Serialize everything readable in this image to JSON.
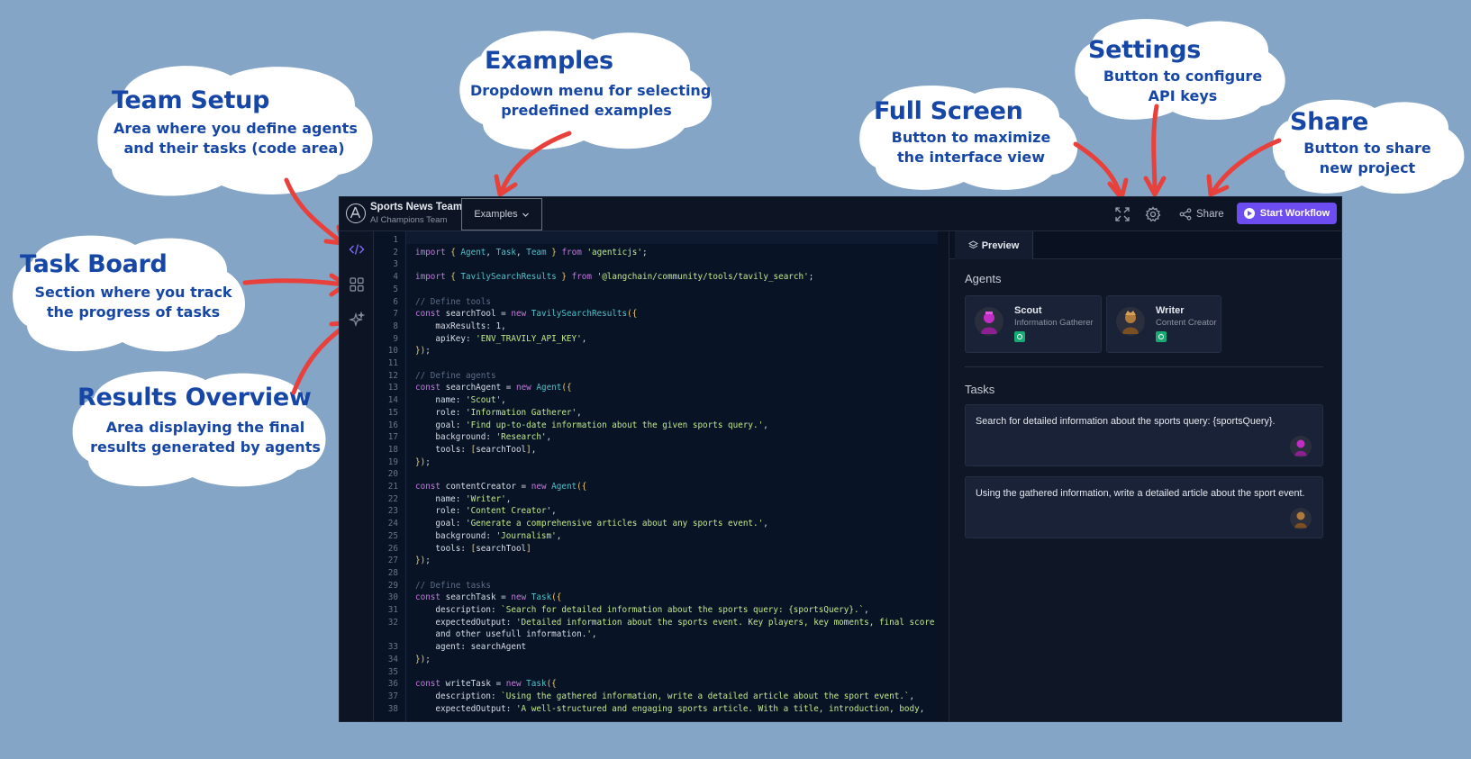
{
  "callouts": {
    "team_setup": {
      "title": "Team Setup",
      "desc1": "Area where you define agents",
      "desc2": "and their tasks (code area)"
    },
    "examples": {
      "title": "Examples",
      "desc1": "Dropdown menu for selecting",
      "desc2": "predefined examples"
    },
    "full_screen": {
      "title": "Full Screen",
      "desc1": "Button to maximize",
      "desc2": "the interface view"
    },
    "settings": {
      "title": "Settings",
      "desc1": "Button to configure",
      "desc2": "API keys"
    },
    "share": {
      "title": "Share",
      "desc1": "Button to share",
      "desc2": "new project"
    },
    "task_board": {
      "title": "Task Board",
      "desc1": "Section where you track",
      "desc2": "the progress of tasks"
    },
    "results": {
      "title": "Results Overview",
      "desc1": "Area displaying the final",
      "desc2": "results generated by agents"
    }
  },
  "colors": {
    "page_bg": "#84a5c5",
    "callout_text": "#1747a6",
    "arrow": "#e8413c",
    "app_bg": "#0b1322",
    "accent": "#6d4df2"
  },
  "topbar": {
    "team_name": "Sports News Team",
    "team_subtitle": "AI Champions Team",
    "examples_label": "Examples",
    "share_label": "Share",
    "start_label": "Start Workflow",
    "icons": [
      "fullscreen-icon",
      "gear-icon",
      "share-icon",
      "play-icon"
    ]
  },
  "sidebar": {
    "icons": [
      "code-icon",
      "grid-icon",
      "sparkle-icon"
    ]
  },
  "editor": {
    "line_numbers": [
      "1",
      "2",
      "3",
      "4",
      "5",
      "6",
      "7",
      "8",
      "9",
      "10",
      "11",
      "12",
      "13",
      "14",
      "15",
      "16",
      "17",
      "18",
      "19",
      "20",
      "21",
      "22",
      "23",
      "24",
      "25",
      "26",
      "27",
      "28",
      "29",
      "30",
      "31",
      "32",
      "",
      "33",
      "34",
      "35",
      "36",
      "37",
      "38"
    ],
    "lines": [
      "",
      "import { Agent, Task, Team } from 'agenticjs';",
      "",
      "import { TavilySearchResults } from '@langchain/community/tools/tavily_search';",
      "",
      "// Define tools",
      "const searchTool = new TavilySearchResults({",
      "    maxResults: 1,",
      "    apiKey: 'ENV_TRAVILY_API_KEY',",
      "});",
      "",
      "// Define agents",
      "const searchAgent = new Agent({",
      "    name: 'Scout',",
      "    role: 'Information Gatherer',",
      "    goal: 'Find up-to-date information about the given sports query.',",
      "    background: 'Research',",
      "    tools: [searchTool],",
      "});",
      "",
      "const contentCreator = new Agent({",
      "    name: 'Writer',",
      "    role: 'Content Creator',",
      "    goal: 'Generate a comprehensive articles about any sports event.',",
      "    background: 'Journalism',",
      "    tools: [searchTool]",
      "});",
      "",
      "// Define tasks",
      "const searchTask = new Task({",
      "    description: `Search for detailed information about the sports query: {sportsQuery}.`,",
      "    expectedOutput: 'Detailed information about the sports event. Key players, key moments, final score",
      "    and other usefull information.',",
      "    agent: searchAgent",
      "});",
      "",
      "const writeTask = new Task({",
      "    description: `Using the gathered information, write a detailed article about the sport event.`,",
      "    expectedOutput: 'A well-structured and engaging sports article. With a title, introduction, body,"
    ]
  },
  "preview": {
    "tab_label": "Preview",
    "agents_title": "Agents",
    "agents": [
      {
        "name": "Scout",
        "role": "Information Gatherer"
      },
      {
        "name": "Writer",
        "role": "Content Creator"
      }
    ],
    "tasks_title": "Tasks",
    "tasks": [
      {
        "text": "Search for detailed information about the sports query: {sportsQuery}."
      },
      {
        "text": "Using the gathered information, write a detailed article about the sport event."
      }
    ]
  }
}
